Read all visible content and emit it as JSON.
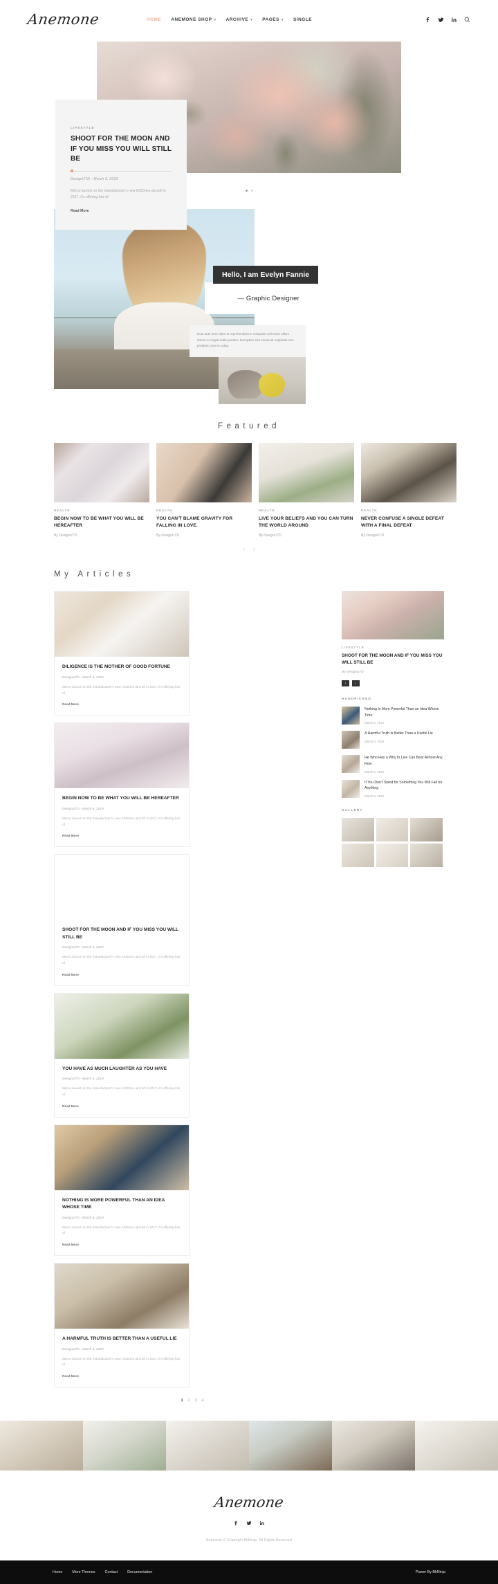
{
  "site": {
    "brand": "Anemone"
  },
  "header": {
    "nav": [
      {
        "label": "HOME",
        "active": true,
        "caret": false
      },
      {
        "label": "ANEMONE SHOP",
        "active": false,
        "caret": true
      },
      {
        "label": "ARCHIVE",
        "active": false,
        "caret": true
      },
      {
        "label": "PAGES",
        "active": false,
        "caret": true
      },
      {
        "label": "SINGLE",
        "active": false,
        "caret": false
      }
    ],
    "icons": [
      "facebook-icon",
      "twitter-icon",
      "linkedin-icon",
      "search-icon"
    ]
  },
  "hero": {
    "category": "LIFESTYLE",
    "title": "SHOOT FOR THE MOON AND IF YOU MISS YOU WILL STILL BE",
    "meta": "DesignUTD - March 6, 2019",
    "excerpt": "Met to launch on the manufacturer's new A330neo aircraft in 2017, it's offering lots of",
    "read_more": "Read More",
    "accent_color": "#e0a07e"
  },
  "intro": {
    "name": "Hello, I am Evelyn Fannie",
    "role": "— Graphic Designer",
    "bio": "Duis aute irure dolor in reprehenderit in voluptate velit esse cillum dolore eu fugiat nulla pariatur. Excepteur sint occaecat cupidatat non proident, sunt in culpa."
  },
  "featured": {
    "heading": "Featured",
    "items": [
      {
        "category": "HEALTH",
        "title": "BEGIN NOW TO BE WHAT YOU WILL BE HEREAFTER",
        "by": "By DesignUTD"
      },
      {
        "category": "HEALTH",
        "title": "YOU CAN'T BLAME GRAVITY FOR FALLING IN LOVE.",
        "by": "By DesignUTD"
      },
      {
        "category": "HEALTH",
        "title": "LIVE YOUR BELIEFS AND YOU CAN TURN THE WORLD AROUND",
        "by": "By DesignUTD"
      },
      {
        "category": "HEALTH",
        "title": "NEVER CONFUSE A SINGLE DEFEAT WITH A FINAL DEFEAT",
        "by": "By DesignUTD"
      }
    ],
    "prev": "‹",
    "next": "›"
  },
  "articles": {
    "heading": "My Articles",
    "items": [
      {
        "title": "DILIGENCE IS THE MOTHER OF GOOD FORTUNE",
        "meta": "DesignUTD - March 6, 2019",
        "excerpt": "Met to launch on the manufacturer's new A330neo aircraft in 2017, it's offering lots of",
        "read_more": "Read More"
      },
      {
        "title": "BEGIN NOW TO BE WHAT YOU WILL BE HEREAFTER",
        "meta": "DesignUTD - March 6, 2019",
        "excerpt": "Met to launch on the manufacturer's new A330neo aircraft in 2017, it's offering lots of",
        "read_more": "Read More"
      },
      {
        "title": "SHOOT FOR THE MOON AND IF YOU MISS YOU WILL STILL BE",
        "meta": "DesignUTD - March 6, 2019",
        "excerpt": "Met to launch on the manufacturer's new A330neo aircraft in 2017, it's offering lots of",
        "read_more": "Read More"
      },
      {
        "title": "YOU HAVE AS MUCH LAUGHTER AS YOU HAVE",
        "meta": "DesignUTD - March 6, 2019",
        "excerpt": "Met to launch on the manufacturer's new A330neo aircraft in 2017, it's offering lots of",
        "read_more": "Read More"
      },
      {
        "title": "NOTHING IS MORE POWERFUL THAN AN IDEA WHOSE TIME",
        "meta": "DesignUTD - March 6, 2019",
        "excerpt": "Met to launch on the manufacturer's new A330neo aircraft in 2017, it's offering lots of",
        "read_more": "Read More"
      },
      {
        "title": "A HARMFUL TRUTH IS BETTER THAN A USEFUL LIE",
        "meta": "DesignUTD - March 6, 2019",
        "excerpt": "Met to launch on the manufacturer's new A330neo aircraft in 2017, it's offering lots of",
        "read_more": "Read More"
      }
    ],
    "pagination": [
      "1",
      "2",
      "3",
      "4"
    ],
    "current_page": "1"
  },
  "sidebar": {
    "feature": {
      "category": "LIFESTYLE",
      "title": "SHOOT FOR THE MOON AND IF YOU MISS YOU WILL STILL BE",
      "by": "By DesignUTD",
      "prev": "‹",
      "next": "›"
    },
    "handpicked": {
      "title": "HANDPICKED",
      "items": [
        {
          "title": "Nothing Is More Powerful Than an Idea Whose Time",
          "date": "March 6, 2019"
        },
        {
          "title": "A Harmful Truth Is Better Than a Useful Lie",
          "date": "March 6, 2019"
        },
        {
          "title": "He Who Has a Why to Live Can Bear Almost Any How",
          "date": "March 6, 2019"
        },
        {
          "title": "If You Don't Stand for Something You Will Fall for Anything",
          "date": "March 6, 2019"
        }
      ]
    },
    "gallery": {
      "title": "GALLERY",
      "cell_count": 6
    }
  },
  "footer": {
    "brand": "Anemone",
    "social": [
      "facebook-icon",
      "twitter-icon",
      "linkedin-icon"
    ],
    "copyright": "Anemone © Copyright BkNinja. All Rights Reserved",
    "bottom_links": [
      "Home",
      "More Themes",
      "Contact",
      "Documentation"
    ],
    "powered_by": "Power By BkNinja"
  }
}
